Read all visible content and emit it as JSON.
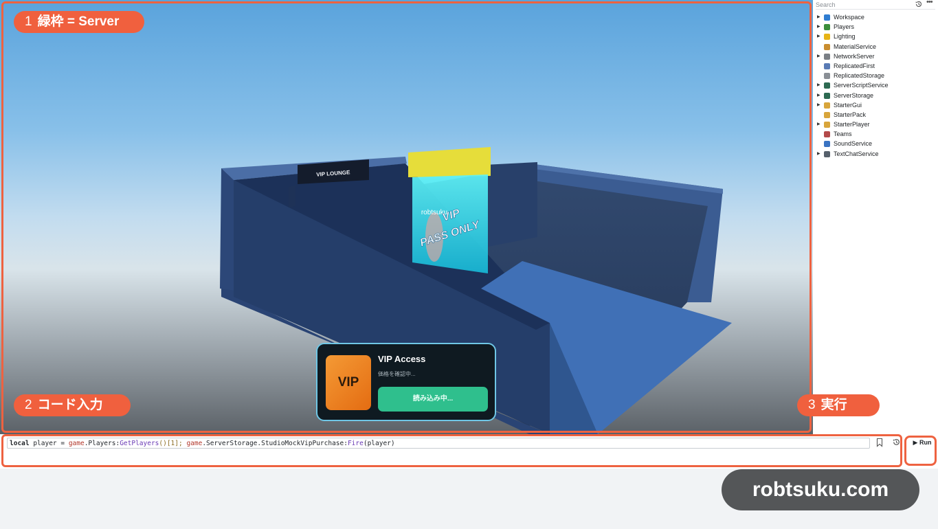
{
  "callouts": [
    {
      "num": "1",
      "label": "緑枠 = Server"
    },
    {
      "num": "2",
      "label": "コード入力"
    },
    {
      "num": "3",
      "label": "実行"
    }
  ],
  "scene": {
    "sign_text": "VIP LOUNGE",
    "nameplate": "robtsuku",
    "door_line1": "VIP",
    "door_line2": "PASS ONLY"
  },
  "vip_popup": {
    "icon_text": "VIP",
    "title": "VIP Access",
    "status": "価格を確認中...",
    "button_label": "読み込み中..."
  },
  "explorer": {
    "search_placeholder": "Search",
    "items": [
      {
        "label": "Workspace",
        "expandable": true,
        "icon": "globe-icon",
        "color": "#2f7dd1"
      },
      {
        "label": "Players",
        "expandable": true,
        "icon": "players-icon",
        "color": "#3b8e3b"
      },
      {
        "label": "Lighting",
        "expandable": true,
        "icon": "lightbulb-icon",
        "color": "#e7b416"
      },
      {
        "label": "MaterialService",
        "expandable": false,
        "icon": "material-icon",
        "color": "#c98d2f"
      },
      {
        "label": "NetworkServer",
        "expandable": true,
        "icon": "network-icon",
        "color": "#7a7f85"
      },
      {
        "label": "ReplicatedFirst",
        "expandable": false,
        "icon": "replicated-first-icon",
        "color": "#5a7bb5"
      },
      {
        "label": "ReplicatedStorage",
        "expandable": false,
        "icon": "replicated-storage-icon",
        "color": "#8a8f96"
      },
      {
        "label": "ServerScriptService",
        "expandable": true,
        "icon": "server-script-icon",
        "color": "#2d6a52"
      },
      {
        "label": "ServerStorage",
        "expandable": true,
        "icon": "server-storage-icon",
        "color": "#2d6a52"
      },
      {
        "label": "StarterGui",
        "expandable": true,
        "icon": "starter-gui-icon",
        "color": "#d8a53b"
      },
      {
        "label": "StarterPack",
        "expandable": false,
        "icon": "starter-pack-icon",
        "color": "#d8a53b"
      },
      {
        "label": "StarterPlayer",
        "expandable": true,
        "icon": "starter-player-icon",
        "color": "#d8a53b"
      },
      {
        "label": "Teams",
        "expandable": false,
        "icon": "teams-icon",
        "color": "#b34a4a"
      },
      {
        "label": "SoundService",
        "expandable": false,
        "icon": "sound-icon",
        "color": "#3a73c2"
      },
      {
        "label": "TextChatService",
        "expandable": true,
        "icon": "text-chat-icon",
        "color": "#56606b"
      }
    ]
  },
  "command": {
    "kw": "local",
    "var": " player = ",
    "g1": "game",
    "t1": ".Players:",
    "m1": "GetPlayers",
    "t2": "()[1]; ",
    "g2": "game",
    "t3": ".ServerStorage.StudioMockVipPurchase:",
    "m2": "Fire",
    "t4": "(player)"
  },
  "run_label": "▶ Run",
  "watermark": "robtsuku.com",
  "colors": {
    "callout": "#f0603e",
    "wall": "#2f4a7c",
    "door_glow": "#33e4f0",
    "popup_button": "#2fbf8d"
  }
}
